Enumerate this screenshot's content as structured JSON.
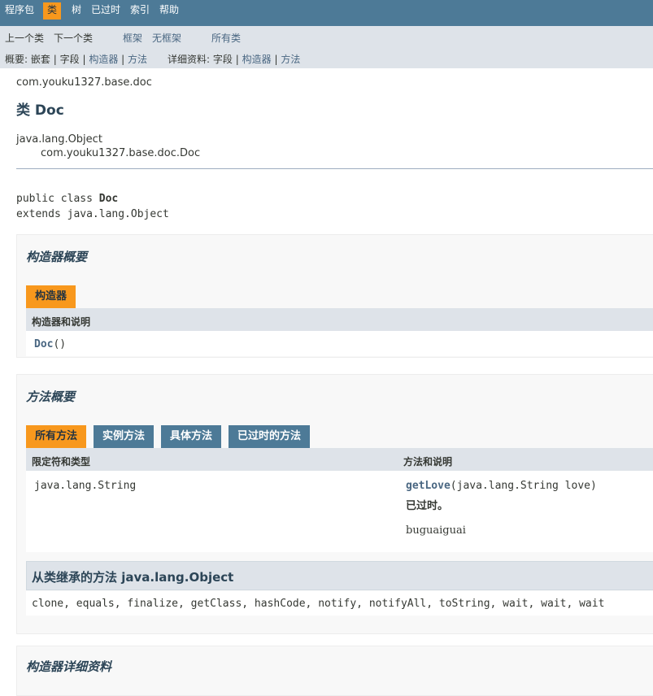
{
  "topnav": {
    "items": [
      "程序包",
      "类",
      "树",
      "已过时",
      "索引",
      "帮助"
    ],
    "active_index": 1
  },
  "subnav": {
    "prev": "上一个类",
    "next": "下一个类",
    "frames": "框架",
    "noframes": "无框架",
    "allclasses": "所有类",
    "summary_label": "概要:",
    "summary_nested": "嵌套",
    "summary_field": "字段",
    "summary_constr": "构造器",
    "summary_method": "方法",
    "detail_label": "详细资料:",
    "detail_field": "字段",
    "detail_constr": "构造器",
    "detail_method": "方法",
    "sep": "|"
  },
  "header": {
    "package": "com.youku1327.base.doc",
    "title": "类 Doc",
    "inherit_parent": "java.lang.Object",
    "inherit_child": "com.youku1327.base.doc.Doc"
  },
  "signature": {
    "line1_prefix": "public class ",
    "line1_name": "Doc",
    "line2": "extends java.lang.Object"
  },
  "constructor_summary": {
    "title": "构造器概要",
    "tab": "构造器",
    "column": "构造器和说明",
    "row_name": "Doc",
    "row_params": "()"
  },
  "method_summary": {
    "title": "方法概要",
    "tabs": [
      "所有方法",
      "实例方法",
      "具体方法",
      "已过时的方法"
    ],
    "col1": "限定符和类型",
    "col2": "方法和说明",
    "row": {
      "type": "java.lang.String",
      "method_name": "getLove",
      "method_params": "(java.lang.String love)",
      "deprecated": "已过时。",
      "description": "buguaiguai"
    },
    "inherited_title": "从类继承的方法 java.lang.Object",
    "inherited_methods": "clone, equals, finalize, getClass, hashCode, notify, notifyAll, toString, wait, wait, wait"
  },
  "constructor_detail": {
    "title": "构造器详细资料"
  },
  "colors": {
    "nav": "#4D7A97",
    "active": "#F8981D",
    "subnav": "#DEE3E9"
  }
}
